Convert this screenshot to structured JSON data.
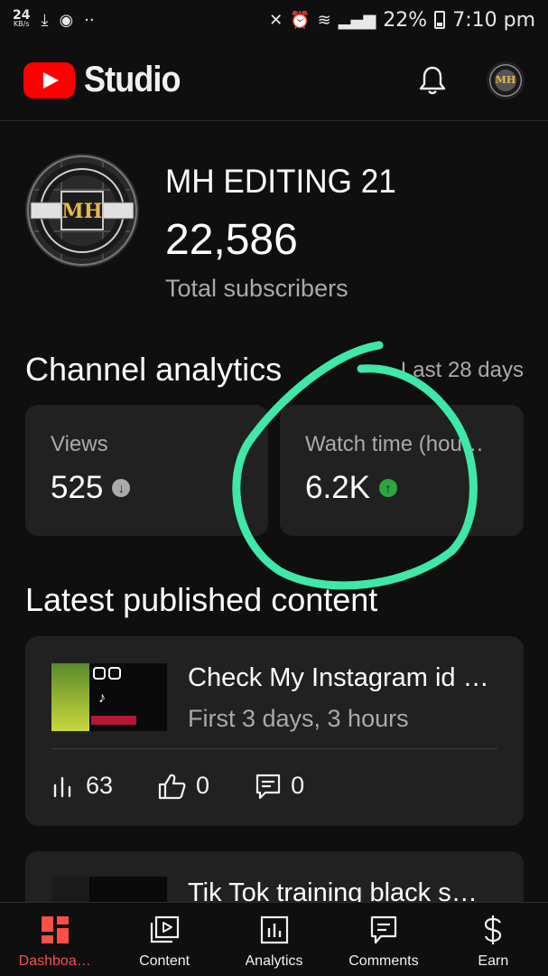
{
  "status_bar": {
    "speed_value": "24",
    "speed_unit": "KB/s",
    "battery": "22%",
    "time": "7:10 pm"
  },
  "app": {
    "name": "Studio"
  },
  "channel": {
    "name": "MH EDITING 21",
    "subscriber_count": "22,586",
    "subscriber_label": "Total subscribers",
    "avatar_text": "MH"
  },
  "analytics": {
    "title": "Channel analytics",
    "period": "Last 28 days",
    "cards": [
      {
        "label": "Views",
        "value": "525",
        "trend": "down"
      },
      {
        "label": "Watch time (hou…",
        "value": "6.2K",
        "trend": "up"
      }
    ]
  },
  "latest": {
    "title": "Latest published content",
    "videos": [
      {
        "title": "Check My Instagram id …",
        "meta": "First 3 days, 3 hours",
        "views": "63",
        "likes": "0",
        "comments": "0"
      },
      {
        "title": "Tik Tok training black s…"
      }
    ]
  },
  "bottom_nav": [
    {
      "label": "Dashboa…",
      "icon": "dashboard-icon",
      "active": true
    },
    {
      "label": "Content",
      "icon": "content-icon",
      "active": false
    },
    {
      "label": "Analytics",
      "icon": "analytics-icon",
      "active": false
    },
    {
      "label": "Comments",
      "icon": "comments-icon",
      "active": false
    },
    {
      "label": "Earn",
      "icon": "dollar-icon",
      "active": false
    }
  ],
  "colors": {
    "background": "#0f0f0f",
    "card": "#212121",
    "accent": "#ff4e45",
    "annotation": "#3ee8a8",
    "trend_up": "#2ba640"
  }
}
